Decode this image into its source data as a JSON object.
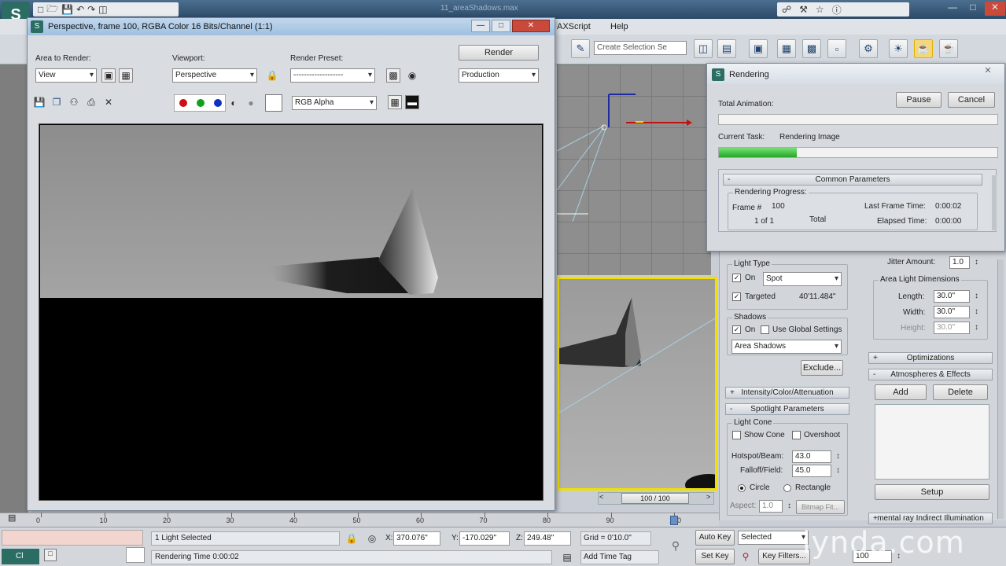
{
  "app": {
    "title": "11_areaShadows.max",
    "menu_script": "AXScript",
    "menu_help": "Help",
    "selection_set_placeholder": "Create Selection Se",
    "colors": {
      "accent_yellow": "#f0e000",
      "progress_green": "#3cc83c",
      "titlebar": "#9ec0e2"
    }
  },
  "quick_access": {
    "icons": [
      "new-icon",
      "open-icon",
      "save-icon",
      "undo-icon",
      "redo-icon",
      "project-icon"
    ],
    "right_icons": [
      "binoculars-icon",
      "tools-icon",
      "star-icon",
      "help-icon"
    ]
  },
  "frame_window": {
    "title": "Perspective, frame 100, RGBA Color 16 Bits/Channel (1:1)",
    "area_label": "Area to Render:",
    "area_value": "View",
    "viewport_label": "Viewport:",
    "viewport_value": "Perspective",
    "preset_label": "Render Preset:",
    "preset_value": "-------------------",
    "render_button": "Render",
    "production_value": "Production",
    "channel_value": "RGB Alpha"
  },
  "rendering_dialog": {
    "title": "Rendering",
    "pause": "Pause",
    "cancel": "Cancel",
    "total_animation_label": "Total Animation:",
    "current_task_label": "Current Task:",
    "current_task_value": "Rendering Image",
    "task_progress": 0.28,
    "section_title": "Common Parameters",
    "progress_group": "Rendering Progress:",
    "frame_label": "Frame #",
    "frame_value": "100",
    "of_value": "1 of 1",
    "total_label": "Total",
    "last_frame_label": "Last Frame Time:",
    "last_frame_value": "0:00:02",
    "elapsed_label": "Elapsed Time:",
    "elapsed_value": "0:00:00"
  },
  "modify_panel": {
    "light_type_group": "Light Type",
    "on_label": "On",
    "light_type_value": "Spot",
    "targeted_label": "Targeted",
    "targeted_value": "40'11.484\"",
    "shadows_group": "Shadows",
    "use_global_label": "Use Global Settings",
    "shadow_type_value": "Area Shadows",
    "exclude_button": "Exclude...",
    "rollout_intensity": "Intensity/Color/Attenuation",
    "rollout_spotlight": "Spotlight Parameters",
    "light_cone_group": "Light Cone",
    "show_cone": "Show Cone",
    "overshoot": "Overshoot",
    "hotspot_label": "Hotspot/Beam:",
    "hotspot_value": "43.0",
    "falloff_label": "Falloff/Field:",
    "falloff_value": "45.0",
    "circle_label": "Circle",
    "rectangle_label": "Rectangle",
    "aspect_label": "Aspect:",
    "aspect_value": "1.0",
    "bitmap_fit": "Bitmap Fit..."
  },
  "right_panel": {
    "jitter_label": "Jitter Amount:",
    "jitter_value": "1.0",
    "area_dims_group": "Area Light Dimensions",
    "length_label": "Length:",
    "length_value": "30.0\"",
    "width_label": "Width:",
    "width_value": "30.0\"",
    "height_label": "Height:",
    "height_value": "30.0\"",
    "rollout_optimizations": "Optimizations",
    "rollout_atmospheres": "Atmospheres & Effects",
    "add_button": "Add",
    "delete_button": "Delete",
    "setup_button": "Setup",
    "rollout_mental_ray": "mental ray Indirect Illumination"
  },
  "timeline": {
    "slider_value": "100 / 100",
    "ticks": [
      "0",
      "10",
      "20",
      "30",
      "40",
      "50",
      "60",
      "70",
      "80",
      "90",
      "100"
    ]
  },
  "status": {
    "selected": "1 Light Selected",
    "rendering_time": "Rendering Time  0:00:02",
    "x_value": "370.076\"",
    "y_value": "-170.029\"",
    "z_value": "249.48\"",
    "grid": "Grid = 0'10.0\"",
    "add_time_tag": "Add Time Tag",
    "auto_key": "Auto Key",
    "set_key": "Set Key",
    "selected_dd": "Selected",
    "key_filters": "Key Filters...",
    "frame_field": "100",
    "listener": "Cl"
  },
  "watermark": "lynda.com"
}
